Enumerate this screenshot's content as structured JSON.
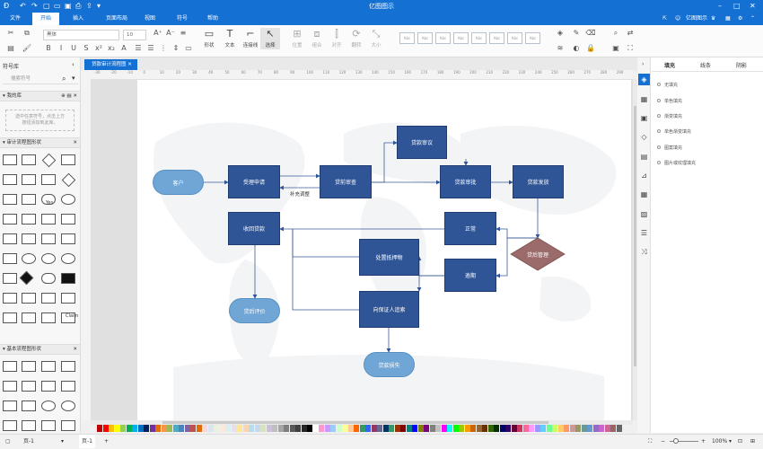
{
  "app": {
    "window_title": "亿图图示"
  },
  "menu": {
    "tabs": [
      "文件",
      "开始",
      "插入",
      "页面布局",
      "视图",
      "符号",
      "帮助"
    ],
    "active_tab": "开始",
    "user": "亿图图示"
  },
  "ribbon": {
    "font_name": "黑体",
    "font_size": "10",
    "tools": {
      "shape": "形状",
      "text": "文本",
      "connector": "连接线",
      "select": "选择"
    },
    "arrange": {
      "position": "位置",
      "group": "组合",
      "align": "对齐",
      "rotate": "翻转",
      "size": "大小"
    },
    "style_sample": "Abc"
  },
  "left_panel": {
    "title": "符号库",
    "search_placeholder": "搜索符号",
    "my_library": "我的库",
    "drop_hint_line1": "选中任意符号，点击上方",
    "drop_hint_line2": "按钮添加到此库。",
    "audit_section": "审计流程图形状",
    "basic_section": "基本流程图形状",
    "yes_label": "Yes",
    "claim_label": "Claim"
  },
  "document": {
    "tab_title": "贷款审计流程图"
  },
  "ruler": {
    "top_ticks": [
      "-30",
      "-20",
      "-10",
      "0",
      "10",
      "20",
      "30",
      "40",
      "50",
      "60",
      "70",
      "80",
      "90",
      "100",
      "110",
      "120",
      "130",
      "140",
      "150",
      "160",
      "170",
      "180",
      "190",
      "200",
      "210",
      "220",
      "230",
      "240",
      "250",
      "260",
      "270",
      "280",
      "290"
    ]
  },
  "flow": {
    "customer": "客户",
    "accept": "受理申请",
    "pre_review": "贷前审查",
    "loan_meeting": "贷款审议",
    "loan_approve": "贷款审批",
    "loan_issue": "贷款发放",
    "normal": "正常",
    "post_manage": "贷后管理",
    "recover": "收回贷款",
    "dispose": "处置抵押物",
    "overdue": "逾期",
    "evaluate": "贷后评价",
    "guarantor": "向保证人追索",
    "loss": "贷款损失",
    "supplement": "补充调整"
  },
  "right_panel": {
    "tabs": [
      "填充",
      "线条",
      "阴影"
    ],
    "active_tab": "填充",
    "fill_options": [
      "无填充",
      "单色填充",
      "渐变填充",
      "单色渐变填充",
      "图案填充",
      "图片或纹理填充"
    ]
  },
  "palette": [
    "#c00000",
    "#ff0000",
    "#ffc000",
    "#ffff00",
    "#92d050",
    "#00b050",
    "#00b0f0",
    "#0070c0",
    "#002060",
    "#7030a0",
    "#e46c0a",
    "#f79646",
    "#9bbb59",
    "#4bacc6",
    "#4f81bd",
    "#8064a2",
    "#c0504d",
    "#e26b0a",
    "#f2dcdb",
    "#dbe5f1",
    "#ebf1dd",
    "#fde9d9",
    "#daeef3",
    "#e5e0ec",
    "#ffe699",
    "#fbd4b4",
    "#b6dde8",
    "#c6d9f0",
    "#d7e4bc",
    "#ccc0da",
    "#bfbfbf",
    "#a6a6a6",
    "#7f7f7f",
    "#595959",
    "#404040",
    "#262626",
    "#000000",
    "#ffffff",
    "#ff99cc",
    "#cc99ff",
    "#99ccff",
    "#ccffcc",
    "#ffff99",
    "#ffcc99",
    "#ff6600",
    "#339966",
    "#3366ff",
    "#993366",
    "#666699",
    "#003366",
    "#339966",
    "#993300",
    "#800000",
    "#008080",
    "#0000ff",
    "#808000",
    "#800080",
    "#808080",
    "#c0c0c0",
    "#ff00ff",
    "#00ffff",
    "#00ff00",
    "#99cc00",
    "#ff9900",
    "#cc6600",
    "#996633",
    "#663300",
    "#336600",
    "#003300",
    "#000066",
    "#330066",
    "#660033",
    "#cc3366",
    "#ff6699",
    "#ff99ff",
    "#9999ff",
    "#66ccff",
    "#66ff99",
    "#ccff66",
    "#ffcc66",
    "#ff9966",
    "#cc9999",
    "#999966",
    "#669999",
    "#6699cc",
    "#9966cc",
    "#cc66cc",
    "#cc6699",
    "#996666",
    "#666666"
  ],
  "status": {
    "page_name": "页-1",
    "page_tab": "页-1",
    "zoom": "100%"
  }
}
